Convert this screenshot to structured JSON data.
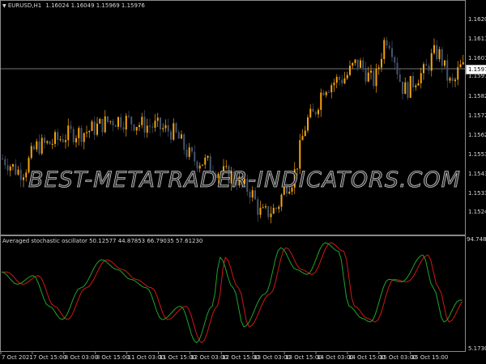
{
  "header": {
    "symbol_label": "EURUSD,H1",
    "ohlc": "1.16024 1.16049 1.15969 1.15976",
    "dropdown_icon": "triangle-down-icon"
  },
  "price_axis": {
    "labels": [
      "1.16205",
      "1.16110",
      "1.16010",
      "1.15915",
      "1.15820",
      "1.15720",
      "1.15625",
      "1.15530",
      "1.15430",
      "1.15335",
      "1.15240"
    ],
    "current_price": "1.15976"
  },
  "indicator": {
    "title": "Averaged stochastic oscillator 50.12577 44.87853 66.79035 57.61230",
    "max_label": "94.74845",
    "min_label": "5.17309"
  },
  "time_axis": {
    "labels": [
      "7 Oct 2021",
      "7 Oct 15:00",
      "8 Oct 03:00",
      "8 Oct 15:00",
      "11 Oct 03:00",
      "11 Oct 15:00",
      "12 Oct 03:00",
      "12 Oct 15:00",
      "13 Oct 03:00",
      "13 Oct 15:00",
      "14 Oct 03:00",
      "14 Oct 15:00",
      "15 Oct 03:00",
      "15 Oct 15:00"
    ]
  },
  "watermark": "BEST-METATRADER-INDICATORS.COM",
  "colors": {
    "bull": "#f5a30f",
    "bear": "#44556e",
    "grid": "#8a8a8a",
    "osc_fast": "#1fa52a",
    "osc_slow": "#d01818"
  },
  "chart_data": {
    "type": "candlestick",
    "price_range": [
      1.1524,
      1.16205
    ],
    "bars": 176,
    "price_path": [
      [
        0,
        1.1556
      ],
      [
        8,
        1.155
      ],
      [
        15,
        1.1562
      ],
      [
        30,
        1.1568
      ],
      [
        45,
        1.1574
      ],
      [
        58,
        1.1571
      ],
      [
        64,
        1.1569
      ],
      [
        75,
        1.1555
      ],
      [
        88,
        1.1548
      ],
      [
        94,
        1.1542
      ],
      [
        100,
        1.153
      ],
      [
        104,
        1.1532
      ],
      [
        110,
        1.1545
      ],
      [
        118,
        1.1575
      ],
      [
        124,
        1.159
      ],
      [
        130,
        1.1593
      ],
      [
        136,
        1.16
      ],
      [
        142,
        1.1592
      ],
      [
        147,
        1.1612
      ],
      [
        154,
        1.1588
      ],
      [
        160,
        1.1595
      ],
      [
        166,
        1.1605
      ],
      [
        172,
        1.159
      ],
      [
        175,
        1.1598
      ]
    ],
    "oscillator": {
      "range": [
        5.17309,
        94.74845
      ],
      "path": [
        [
          0,
          68
        ],
        [
          6,
          58
        ],
        [
          12,
          65
        ],
        [
          18,
          40
        ],
        [
          23,
          29
        ],
        [
          30,
          55
        ],
        [
          38,
          78
        ],
        [
          44,
          70
        ],
        [
          49,
          62
        ],
        [
          55,
          55
        ],
        [
          61,
          29
        ],
        [
          68,
          40
        ],
        [
          74,
          10
        ],
        [
          80,
          40
        ],
        [
          83,
          80
        ],
        [
          88,
          55
        ],
        [
          92,
          23
        ],
        [
          100,
          50
        ],
        [
          106,
          88
        ],
        [
          112,
          70
        ],
        [
          116,
          66
        ],
        [
          123,
          92
        ],
        [
          128,
          85
        ],
        [
          132,
          40
        ],
        [
          137,
          30
        ],
        [
          140,
          27
        ],
        [
          147,
          62
        ],
        [
          152,
          60
        ],
        [
          160,
          82
        ],
        [
          164,
          55
        ],
        [
          168,
          27
        ],
        [
          174,
          45
        ]
      ]
    }
  }
}
